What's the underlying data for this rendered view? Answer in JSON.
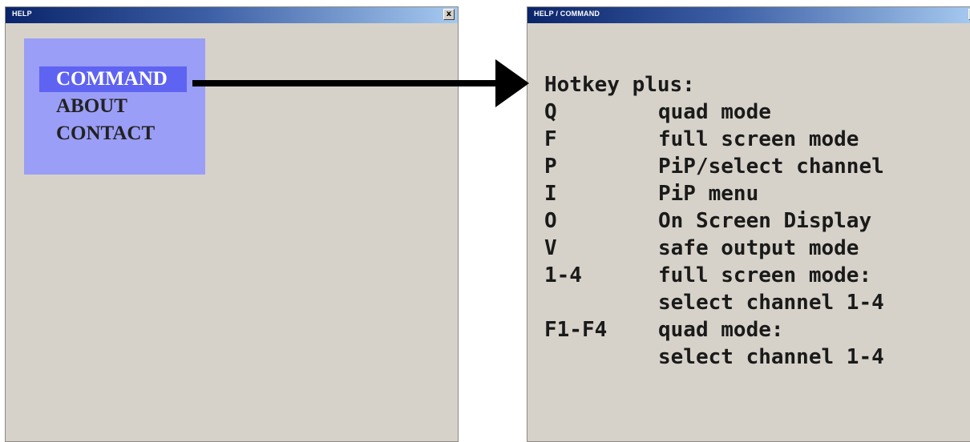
{
  "help_window": {
    "title": "HELP",
    "close_label": "x",
    "menu": {
      "items": [
        {
          "label": "COMMAND",
          "selected": true
        },
        {
          "label": "ABOUT",
          "selected": false
        },
        {
          "label": "CONTACT",
          "selected": false
        }
      ]
    }
  },
  "command_window": {
    "title": "HELP / COMMAND",
    "close_label": "x",
    "heading": "Hotkey plus:",
    "commands": [
      {
        "key": "Q",
        "desc": "quad mode"
      },
      {
        "key": "F",
        "desc": "full screen mode"
      },
      {
        "key": "P",
        "desc": "PiP/select channel"
      },
      {
        "key": "I",
        "desc": "PiP menu"
      },
      {
        "key": "O",
        "desc": "On Screen Display"
      },
      {
        "key": "V",
        "desc": "safe output mode"
      },
      {
        "key": "1-4",
        "desc": "full screen mode:"
      },
      {
        "key": "",
        "desc": "select channel 1-4"
      },
      {
        "key": "F1-F4",
        "desc": "quad mode:"
      },
      {
        "key": "",
        "desc": "select channel 1-4"
      }
    ]
  },
  "colors": {
    "window_bg": "#d6d2c9",
    "menu_bg": "#9a9ef6",
    "menu_selected_bg": "#5f63f2",
    "arrow": "#000000"
  }
}
